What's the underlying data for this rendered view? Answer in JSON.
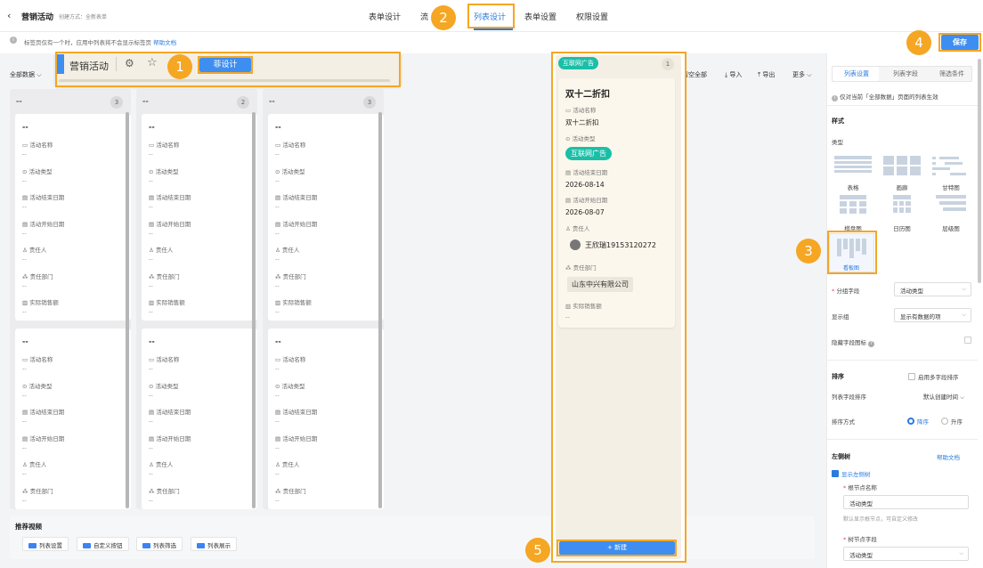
{
  "header": {
    "back_icon": "chevron-left-icon",
    "app_name": "营销活动",
    "create_mode": "创建方式：全新表单",
    "tabs": [
      {
        "label": "表单设计"
      },
      {
        "label": "流"
      },
      {
        "label": "列表设计",
        "active": true
      },
      {
        "label": "表单设置"
      },
      {
        "label": "权限设置"
      }
    ]
  },
  "info_bar": {
    "text": "标签页仅有一个时，应用中列表将不会显示标签页",
    "help_link": "帮助文档"
  },
  "save_label": "保存",
  "popup": {
    "title": "营销活动",
    "gear_icon": "gear-icon",
    "star_icon": "star-icon",
    "design_button": "菲设计"
  },
  "toolbar": {
    "filter_label": "全部数据",
    "clear_all": "清空全部",
    "import": "导入",
    "export": "导出",
    "more": "更多"
  },
  "board": {
    "columns": [
      {
        "title": "--",
        "count": "3"
      },
      {
        "title": "--",
        "count": "2"
      },
      {
        "title": "--",
        "count": "3"
      }
    ],
    "card_title": "--",
    "empty_value": "--",
    "fields_top": [
      {
        "label": "活动名称",
        "icon": "text-field-icon"
      },
      {
        "label": "活动类型",
        "icon": "select-field-icon"
      },
      {
        "label": "活动结束日期",
        "icon": "calendar-icon"
      },
      {
        "label": "活动开始日期",
        "icon": "calendar-icon"
      },
      {
        "label": "责任人",
        "icon": "person-icon"
      },
      {
        "label": "责任部门",
        "icon": "department-icon"
      },
      {
        "label": "实际销售额",
        "icon": "number-field-icon"
      }
    ],
    "fields_bottom": [
      {
        "label": "活动名称"
      },
      {
        "label": "活动类型"
      },
      {
        "label": "活动结束日期"
      },
      {
        "label": "活动开始日期"
      },
      {
        "label": "责任人"
      },
      {
        "label": "责任部门"
      }
    ],
    "col3_labels_top": [
      "活动名称",
      "活动类型",
      "活动结束日期",
      "活动开始日期",
      "责任人",
      "责任部门",
      "实际销售额"
    ],
    "col3_labels_bottom": [
      "活动名称",
      "活动类型",
      "活动结束日期",
      "活动开始日期",
      "责任人",
      "责任部门"
    ]
  },
  "videos": {
    "title": "推荐视频",
    "items": [
      {
        "label": "列表设置"
      },
      {
        "label": "自定义按钮"
      },
      {
        "label": "列表筛选"
      },
      {
        "label": "列表展示"
      }
    ]
  },
  "preview": {
    "group_tag": "互联网广告",
    "count": "1",
    "card": {
      "title": "双十二折扣",
      "name_label": "活动名称",
      "name_value": "双十二折扣",
      "type_label": "活动类型",
      "type_value": "互联网广告",
      "end_label": "活动结束日期",
      "end_value": "2026-08-14",
      "start_label": "活动开始日期",
      "start_value": "2026-08-07",
      "owner_label": "责任人",
      "owner_value": "王欣瑞19153120272",
      "dept_label": "责任部门",
      "dept_value": "山东中兴有限公司",
      "sales_label": "实际销售额",
      "sales_value": "--"
    },
    "new_button": "+ 新建"
  },
  "settings": {
    "tabs": [
      {
        "label": "列表设置",
        "active": true
      },
      {
        "label": "列表字段"
      },
      {
        "label": "筛选条件"
      }
    ],
    "note": "仅对当前「全部数据」页面的列表生效",
    "style_section": "样式",
    "type_label": "类型",
    "types": [
      {
        "label": "表格",
        "icon": "table-view-icon"
      },
      {
        "label": "画廊",
        "icon": "gallery-view-icon"
      },
      {
        "label": "甘特图",
        "icon": "gantt-view-icon"
      },
      {
        "label": "棋盘图",
        "icon": "grid-view-icon"
      },
      {
        "label": "日历图",
        "icon": "calendar-view-icon"
      },
      {
        "label": "层级图",
        "icon": "hierarchy-view-icon"
      },
      {
        "label": "看板图",
        "icon": "kanban-view-icon",
        "selected": true
      }
    ],
    "group_field_label": "分组字段",
    "group_field_value": "活动类型",
    "display_label": "显示组",
    "display_value": "显示有数据的项",
    "hide_icon_label": "隐藏字段图标",
    "sort_section": "排序",
    "multi_sort_label": "启用多字段排序",
    "sort_field_label": "列表字段排序",
    "sort_field_value": "默认创建时间",
    "sort_order_label": "排序方式",
    "sort_desc": "降序",
    "sort_asc": "升序",
    "tree_section": "左侧树",
    "tree_help": "帮助文档",
    "show_tree_label": "显示左侧树",
    "root_name_label": "根节点名称",
    "root_name_value": "活动类型",
    "root_name_hint": "默认显示根节点，可自定义修改",
    "tree_field_label": "树节点字段",
    "tree_field_value": "活动类型"
  },
  "annotations": [
    "1",
    "2",
    "3",
    "4",
    "5"
  ],
  "colors": {
    "accent": "#2a7be0",
    "annotation": "#f5a623",
    "tag": "#1bbfa8"
  }
}
